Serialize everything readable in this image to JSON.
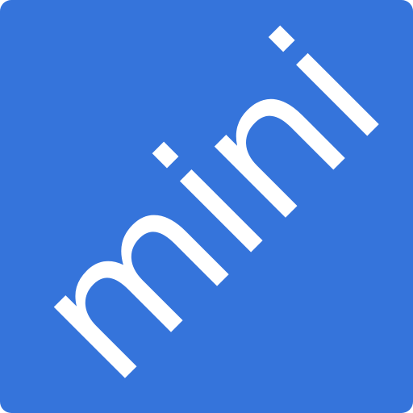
{
  "icon": {
    "wordmark": "mini",
    "background_color": "#3574DB",
    "text_color": "#FFFFFF"
  }
}
